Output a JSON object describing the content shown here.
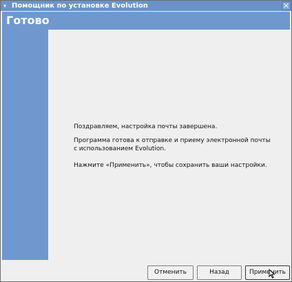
{
  "window": {
    "title": "Помощник по установке Evolution",
    "menu_glyph": "▾",
    "close_glyph": "✕"
  },
  "header": {
    "title": "Готово"
  },
  "content": {
    "line1": "Поздравляем, настройка почты завершена.",
    "line2": "Программа готова к отправке и приему электронной почты",
    "line3": "с использованием Evolution.",
    "line4": "Нажмите «Применить», чтобы сохранить ваши настройки."
  },
  "buttons": {
    "cancel": "Отменить",
    "back": "Назад",
    "apply": "Применить"
  },
  "colors": {
    "accent": "#6f98cf",
    "titlebar": "#6b93c9",
    "background": "#efefef"
  }
}
